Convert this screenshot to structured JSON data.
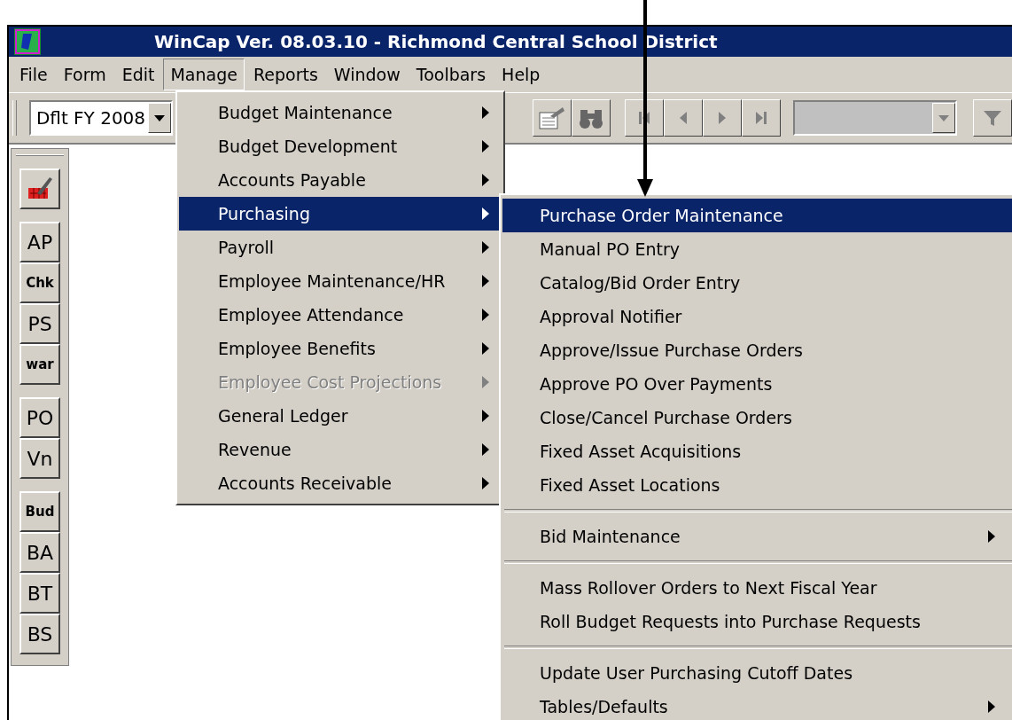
{
  "window": {
    "title": "WinCap Ver. 08.03.10 - Richmond Central School District"
  },
  "menu_bar": [
    {
      "label": "File",
      "selected": false
    },
    {
      "label": "Form",
      "selected": false
    },
    {
      "label": "Edit",
      "selected": false
    },
    {
      "label": "Manage",
      "selected": true
    },
    {
      "label": "Reports",
      "selected": false
    },
    {
      "label": "Window",
      "selected": false
    },
    {
      "label": "Toolbars",
      "selected": false
    },
    {
      "label": "Help",
      "selected": false
    }
  ],
  "toolbar": {
    "fiscal_year": "Dflt FY 2008"
  },
  "side_toolbar": {
    "groups": [
      {
        "buttons": [
          {
            "label": "AP"
          },
          {
            "label": "Chk"
          },
          {
            "label": "PS"
          },
          {
            "label": "war"
          }
        ]
      },
      {
        "buttons": [
          {
            "label": "PO"
          },
          {
            "label": "Vn"
          }
        ]
      },
      {
        "buttons": [
          {
            "label": "Bud"
          },
          {
            "label": "BA"
          },
          {
            "label": "BT"
          },
          {
            "label": "BS"
          }
        ]
      }
    ]
  },
  "manage_menu": [
    {
      "label": "Budget Maintenance",
      "selected": false,
      "disabled": false
    },
    {
      "label": "Budget Development",
      "selected": false,
      "disabled": false
    },
    {
      "label": "Accounts Payable",
      "selected": false,
      "disabled": false
    },
    {
      "label": "Purchasing",
      "selected": true,
      "disabled": false
    },
    {
      "label": "Payroll",
      "selected": false,
      "disabled": false
    },
    {
      "label": "Employee Maintenance/HR",
      "selected": false,
      "disabled": false
    },
    {
      "label": "Employee Attendance",
      "selected": false,
      "disabled": false
    },
    {
      "label": "Employee Benefits",
      "selected": false,
      "disabled": false
    },
    {
      "label": "Employee Cost Projections",
      "selected": false,
      "disabled": true
    },
    {
      "label": "General Ledger",
      "selected": false,
      "disabled": false
    },
    {
      "label": "Revenue",
      "selected": false,
      "disabled": false
    },
    {
      "label": "Accounts Receivable",
      "selected": false,
      "disabled": false
    }
  ],
  "purchasing_submenu": {
    "groups": [
      {
        "items": [
          {
            "label": "Purchase Order Maintenance",
            "selected": true,
            "submenu": false
          },
          {
            "label": "Manual PO Entry",
            "selected": false,
            "submenu": false
          },
          {
            "label": "Catalog/Bid Order Entry",
            "selected": false,
            "submenu": false
          },
          {
            "label": "Approval Notifier",
            "selected": false,
            "submenu": false
          },
          {
            "label": "Approve/Issue Purchase Orders",
            "selected": false,
            "submenu": false
          },
          {
            "label": "Approve PO Over Payments",
            "selected": false,
            "submenu": false
          },
          {
            "label": "Close/Cancel Purchase Orders",
            "selected": false,
            "submenu": false
          },
          {
            "label": "Fixed Asset Acquisitions",
            "selected": false,
            "submenu": false
          },
          {
            "label": "Fixed Asset Locations",
            "selected": false,
            "submenu": false
          }
        ]
      },
      {
        "items": [
          {
            "label": "Bid Maintenance",
            "selected": false,
            "submenu": true
          }
        ]
      },
      {
        "items": [
          {
            "label": "Mass Rollover Orders to Next Fiscal Year",
            "selected": false,
            "submenu": false
          },
          {
            "label": "Roll Budget Requests into Purchase Requests",
            "selected": false,
            "submenu": false
          }
        ]
      },
      {
        "items": [
          {
            "label": "Update User Purchasing Cutoff Dates",
            "selected": false,
            "submenu": false
          },
          {
            "label": "Tables/Defaults",
            "selected": false,
            "submenu": true
          }
        ]
      }
    ]
  }
}
